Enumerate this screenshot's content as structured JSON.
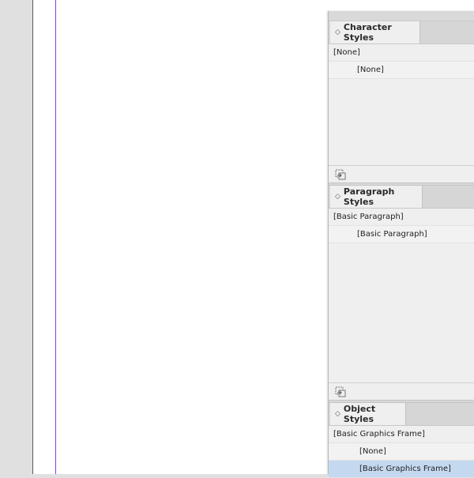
{
  "panels": {
    "character_styles": {
      "tab_label": "Character Styles",
      "selected_style": "[None]",
      "items": [
        "[None]"
      ]
    },
    "paragraph_styles": {
      "tab_label": "Paragraph Styles",
      "selected_style": "[Basic Paragraph]",
      "items": [
        "[Basic Paragraph]"
      ]
    },
    "object_styles": {
      "tab_label": "Object Styles",
      "selected_style": "[Basic Graphics Frame]",
      "items": [
        "[None]",
        "[Basic Graphics Frame]"
      ]
    }
  },
  "icons": {
    "tab_chevron": "chevron-updown-icon",
    "footer": "load-styles-icon"
  },
  "colors": {
    "margin_guide": "#8a3fd1",
    "selection": "#c4d9f0"
  }
}
